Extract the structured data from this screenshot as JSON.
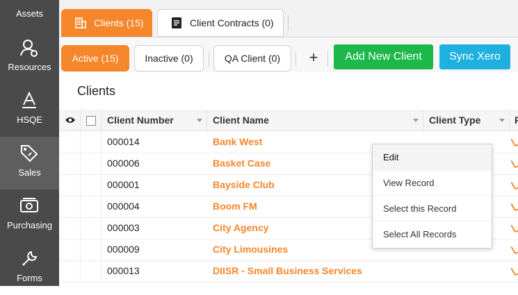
{
  "sidebar": {
    "items": [
      {
        "label": "Assets",
        "icon": "assets-icon"
      },
      {
        "label": "Resources",
        "icon": "resources-icon"
      },
      {
        "label": "HSQE",
        "icon": "hsqe-icon"
      },
      {
        "label": "Sales",
        "icon": "sales-tag-icon",
        "active": true
      },
      {
        "label": "Purchasing",
        "icon": "purchasing-icon"
      },
      {
        "label": "Forms",
        "icon": "wrench-icon"
      }
    ]
  },
  "tabs": [
    {
      "label": "Clients (15)",
      "icon": "building-icon",
      "active": true
    },
    {
      "label": "Client Contracts (0)",
      "icon": "document-icon",
      "active": false
    }
  ],
  "subtabs": [
    {
      "label": "Active (15)",
      "active": true
    },
    {
      "label": "Inactive (0)",
      "active": false
    },
    {
      "label": "QA Client (0)",
      "active": false
    }
  ],
  "actions": {
    "plus": "+",
    "add_new_client": "Add New Client",
    "sync_xero": "Sync Xero"
  },
  "section_title": "Clients",
  "table": {
    "columns": [
      "Client Number",
      "Client Name",
      "Client Type",
      "F"
    ],
    "rows": [
      {
        "number": "000014",
        "name": "Bank West"
      },
      {
        "number": "000006",
        "name": "Basket Case"
      },
      {
        "number": "000001",
        "name": "Bayside Club"
      },
      {
        "number": "000004",
        "name": "Boom FM"
      },
      {
        "number": "000003",
        "name": "City Agency"
      },
      {
        "number": "000009",
        "name": "City Limousines"
      },
      {
        "number": "000013",
        "name": "DIISR - Small Business Services"
      }
    ]
  },
  "context_menu": {
    "items": [
      "Edit",
      "View Record",
      "Select this Record",
      "Select All Records"
    ]
  },
  "colors": {
    "accent_orange": "#f5862a",
    "green_button": "#1cb84a",
    "cyan_button": "#1eb1e0",
    "sidebar_bg": "#4a4a4a"
  }
}
